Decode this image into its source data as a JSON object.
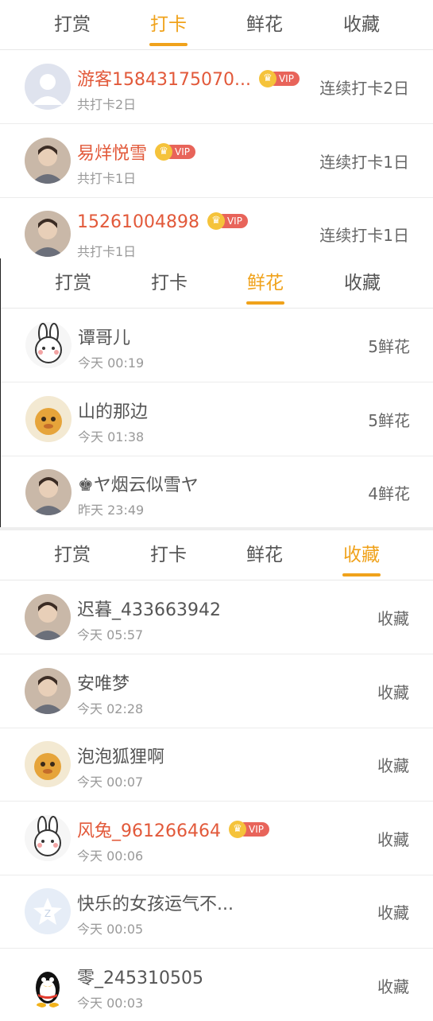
{
  "accent_color": "#f0a21b",
  "vip_color": "#e2593a",
  "panels": [
    {
      "tabs": [
        "打赏",
        "打卡",
        "鲜花",
        "收藏"
      ],
      "active_tab": 1,
      "rows": [
        {
          "name": "游客15843175070...",
          "sub": "共打卡2日",
          "right": "连续打卡2日",
          "vip": true,
          "avatar": "default-user-avatar"
        },
        {
          "name": "易烊悦雪",
          "sub": "共打卡1日",
          "right": "连续打卡1日",
          "vip": true,
          "avatar": "photo-avatar"
        },
        {
          "name": "15261004898",
          "sub": "共打卡1日",
          "right": "连续打卡1日",
          "vip": true,
          "avatar": "photo-avatar"
        }
      ]
    },
    {
      "tabs": [
        "打赏",
        "打卡",
        "鲜花",
        "收藏"
      ],
      "active_tab": 2,
      "rows": [
        {
          "name": "谭哥儿",
          "sub": "今天 00:19",
          "right": "5鲜花",
          "vip": false,
          "avatar": "rabbit-cartoon-avatar"
        },
        {
          "name": "山的那边",
          "sub": "今天 01:38",
          "right": "5鲜花",
          "vip": false,
          "avatar": "cartoon-avatar"
        },
        {
          "name": "♚ヤ烟云似雪ヤ",
          "sub": "昨天 23:49",
          "right": "4鲜花",
          "vip": false,
          "avatar": "photo-avatar"
        }
      ]
    },
    {
      "tabs": [
        "打赏",
        "打卡",
        "鲜花",
        "收藏"
      ],
      "active_tab": 3,
      "rows": [
        {
          "name": "迟暮_433663942",
          "sub": "今天 05:57",
          "right": "收藏",
          "vip": false,
          "avatar": "photo-avatar"
        },
        {
          "name": "安唯梦",
          "sub": "今天 02:28",
          "right": "收藏",
          "vip": false,
          "avatar": "photo-avatar"
        },
        {
          "name": "泡泡狐狸啊",
          "sub": "今天 00:07",
          "right": "收藏",
          "vip": false,
          "avatar": "cartoon-avatar"
        },
        {
          "name": "风兔_961266464",
          "sub": "今天 00:06",
          "right": "收藏",
          "vip": true,
          "avatar": "rabbit-cartoon-avatar"
        },
        {
          "name": "快乐的女孩运气不...",
          "sub": "今天 00:05",
          "right": "收藏",
          "vip": false,
          "avatar": "qzone-default-avatar"
        },
        {
          "name": "零_245310505",
          "sub": "今天 00:03",
          "right": "收藏",
          "vip": false,
          "avatar": "penguin-avatar"
        }
      ]
    }
  ],
  "badge": {
    "vip_label": "VIP",
    "crown_icon": "crown-icon"
  }
}
